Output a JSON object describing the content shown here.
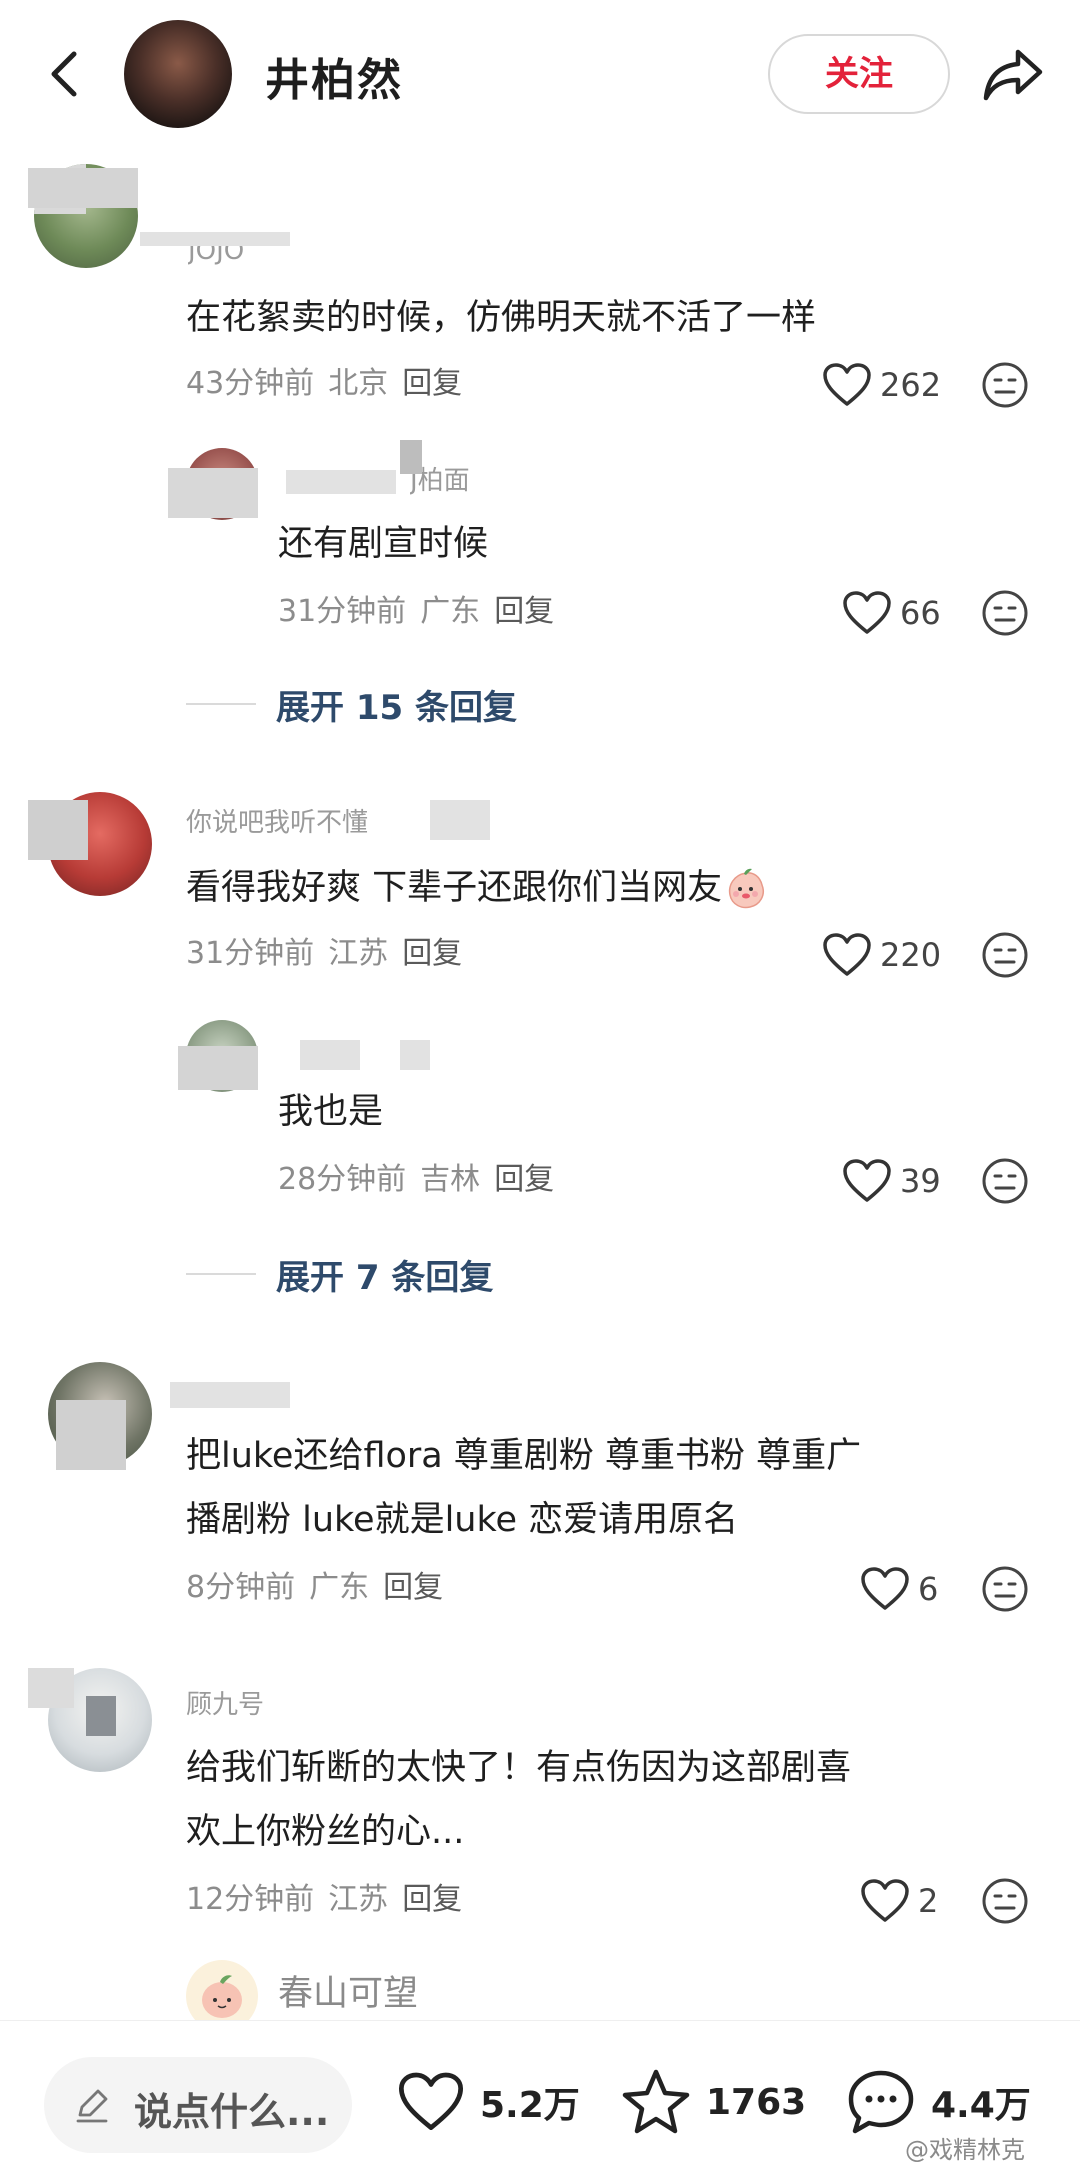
{
  "header": {
    "title": "井柏然",
    "follow_label": "关注"
  },
  "comments": [
    {
      "username_fragment": "JOJO",
      "text": "在花絮卖的时候，仿佛明天就不活了一样",
      "time": "43分钟前",
      "location": "北京",
      "reply_label": "回复",
      "likes": "262",
      "replies": [
        {
          "username_fragment": "J柏面",
          "text": "还有剧宣时候",
          "time": "31分钟前",
          "location": "广东",
          "reply_label": "回复",
          "likes": "66"
        }
      ],
      "expand_label": "展开 15 条回复"
    },
    {
      "username_fragment": "你说吧我听不懂",
      "text": "看得我好爽 下辈子还跟你们当网友",
      "time": "31分钟前",
      "location": "江苏",
      "reply_label": "回复",
      "likes": "220",
      "replies": [
        {
          "username_fragment": "",
          "text": "我也是",
          "time": "28分钟前",
          "location": "吉林",
          "reply_label": "回复",
          "likes": "39"
        }
      ],
      "expand_label": "展开 7 条回复"
    },
    {
      "username_fragment": "",
      "text_lines": [
        "把luke还给flora   尊重剧粉 尊重书粉 尊重广",
        "播剧粉 luke就是luke  恋爱请用原名"
      ],
      "time": "8分钟前",
      "location": "广东",
      "reply_label": "回复",
      "likes": "6"
    },
    {
      "username_fragment": "顾九号",
      "text_lines": [
        "给我们斩断的太快了！有点伤因为这部剧喜",
        "欢上你粉丝的心..."
      ],
      "time": "12分钟前",
      "location": "江苏",
      "reply_label": "回复",
      "likes": "2"
    }
  ],
  "next_reply_preview": {
    "username": "春山可望"
  },
  "bottom_bar": {
    "input_placeholder": "说点什么...",
    "likes": "5.2万",
    "favorites": "1763",
    "comments": "4.4万"
  },
  "watermark": "@戏精林克",
  "colors": {
    "accent_red": "#e3223a",
    "expand_link": "#2e4a6b",
    "meta_gray": "#8c8c8c"
  },
  "icons": {
    "back": "chevron-left-icon",
    "share": "share-arrow-icon",
    "like": "heart-outline-icon",
    "dislike": "meh-face-icon",
    "edit": "pencil-icon",
    "favorite": "star-outline-icon",
    "comment": "speech-bubble-icon",
    "emoji": "peach-face-emoji"
  }
}
